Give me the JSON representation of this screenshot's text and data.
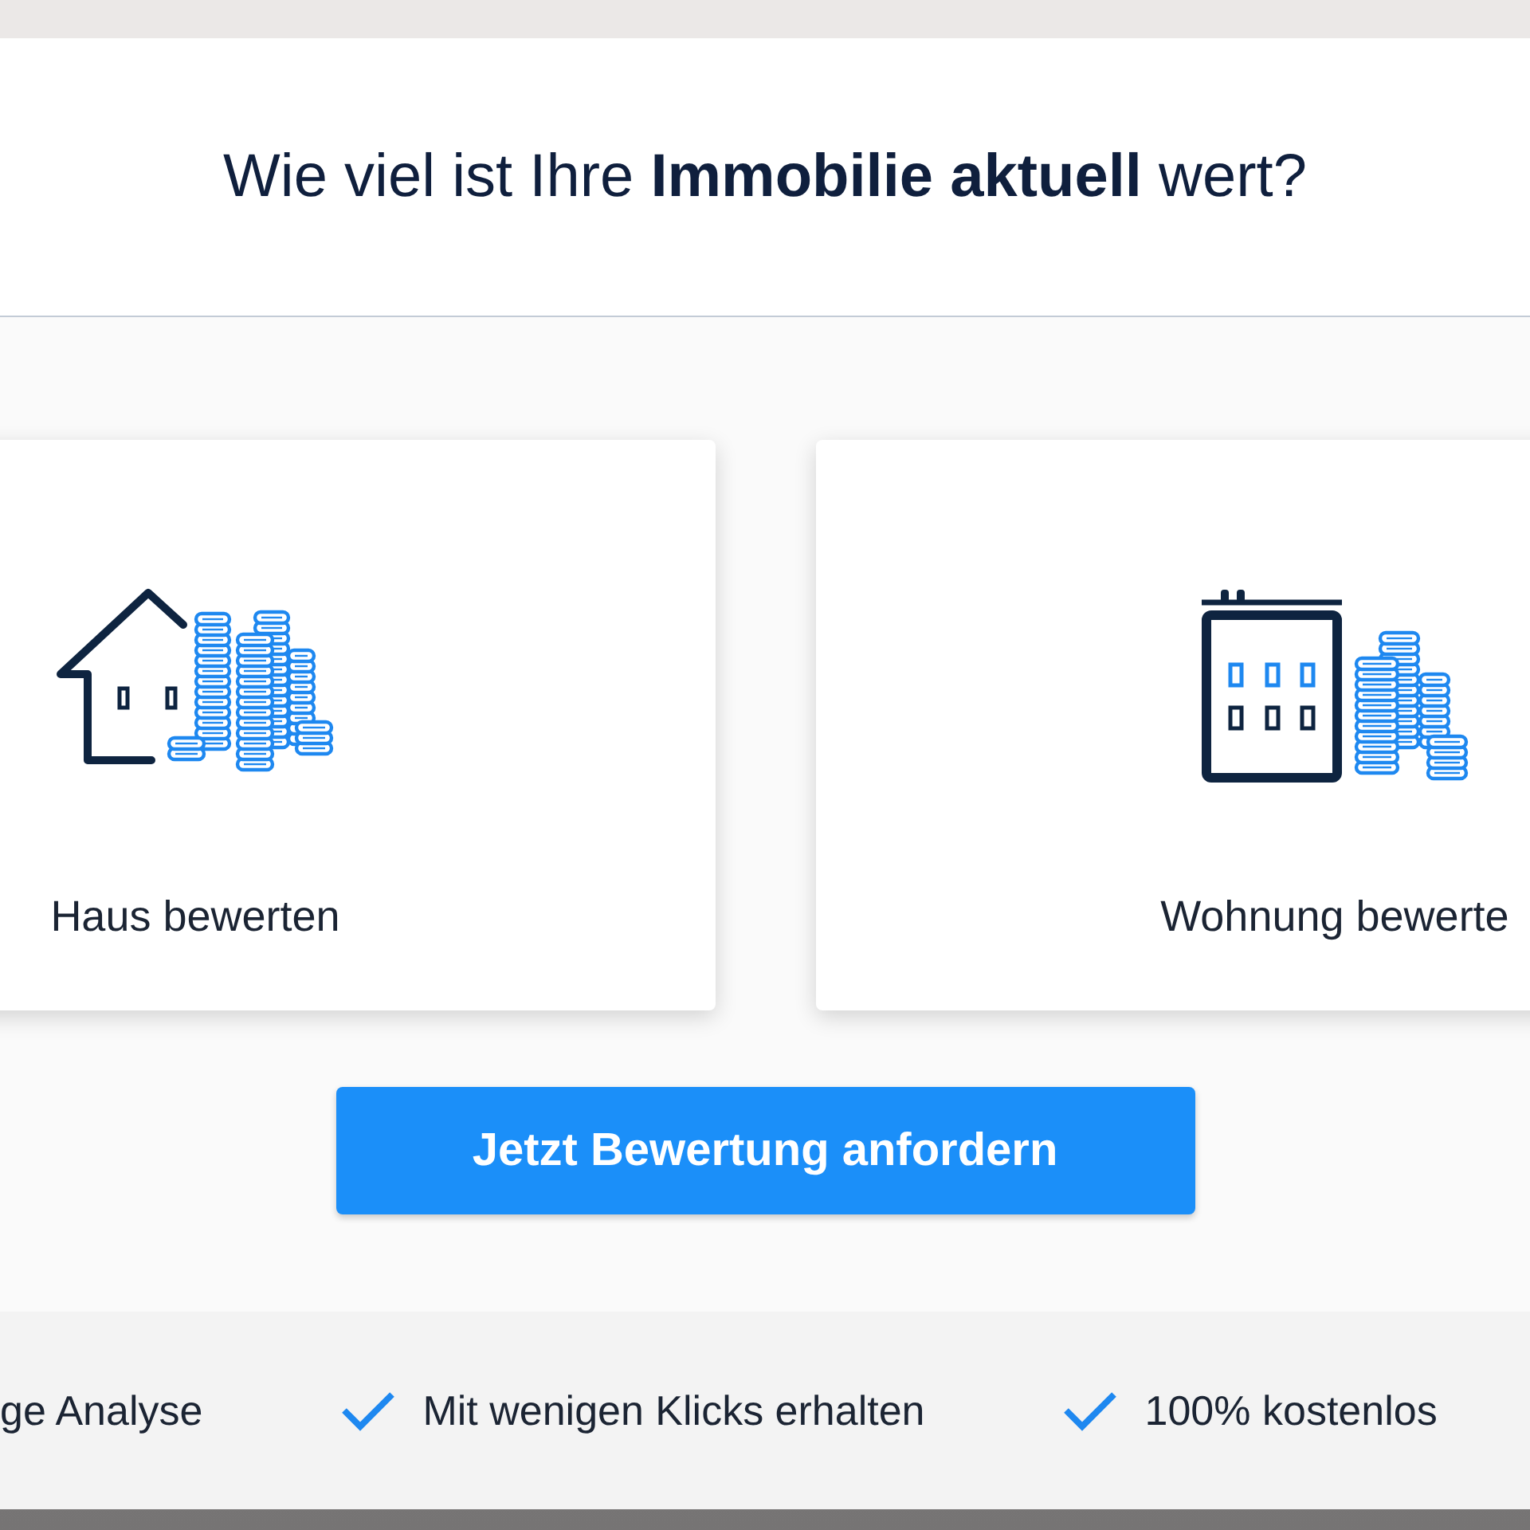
{
  "title": "Wie viel ist Ihre **Immobilie aktuell** wert?",
  "property_types": [
    {
      "kind": "house",
      "label": "Haus bewerten"
    },
    {
      "kind": "apartment",
      "label": "Wohnung bewerte"
    }
  ],
  "cta_button": {
    "label": "Jetzt Bewertung anfordern"
  },
  "benefits": [
    {
      "kind": "text",
      "label": "ge Analyse"
    },
    {
      "kind": "check",
      "label": "Mit wenigen Klicks erhalten"
    },
    {
      "kind": "check",
      "label": "100% kostenlos"
    }
  ]
}
